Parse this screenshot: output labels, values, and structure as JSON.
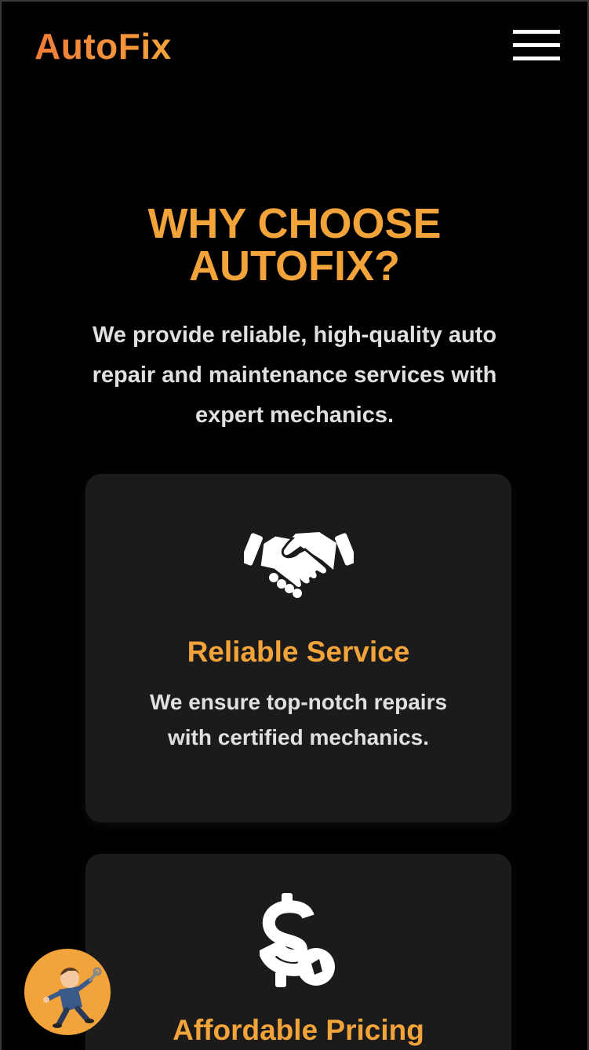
{
  "header": {
    "brand": "AutoFix",
    "menu_icon": "hamburger-menu-icon"
  },
  "why": {
    "title_line1": "WHY CHOOSE",
    "title_line2": "AUTOFIX?",
    "intro_line1": "We provide reliable, high-quality auto",
    "intro_line2": "repair and maintenance services with",
    "intro_line3": "expert mechanics."
  },
  "cards": [
    {
      "icon": "handshake-icon",
      "title": "Reliable Service",
      "text_line1": "We ensure top-notch repairs",
      "text_line2": "with certified mechanics."
    },
    {
      "icon": "dollar-coin-icon",
      "title": "Affordable Pricing"
    }
  ],
  "fab": {
    "icon": "mechanic-mascot-icon"
  },
  "colors": {
    "accent": "#f2a33a",
    "brand_gradient_start": "#f07c3a",
    "background": "#000000",
    "card": "#1b1b1b",
    "text": "#e0e0e0"
  }
}
